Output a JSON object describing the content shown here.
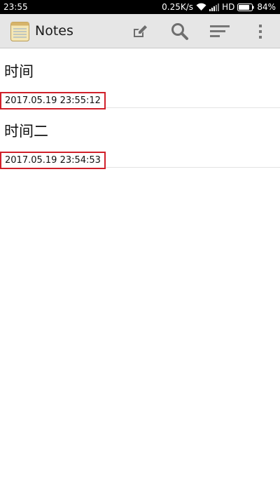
{
  "status_bar": {
    "time": "23:55",
    "network_speed": "0.25K/s",
    "network_type": "HD",
    "battery_percent": "84%",
    "battery_level": 0.84
  },
  "action_bar": {
    "app_name": "Notes",
    "icons": {
      "app": "notes-app-icon",
      "new_note": "edit-pencil-icon",
      "search": "search-icon",
      "sort": "sort-icon",
      "more": "overflow-menu-icon"
    }
  },
  "notes": [
    {
      "title": "时间",
      "date": "2017.05.19 23:55:12"
    },
    {
      "title": "时间二",
      "date": "2017.05.19 23:54:53"
    }
  ],
  "colors": {
    "status_bar_bg": "#000000",
    "action_bar_bg": "#e6e6e6",
    "highlight_border": "#d0202a",
    "divider": "#e3e3e3"
  }
}
